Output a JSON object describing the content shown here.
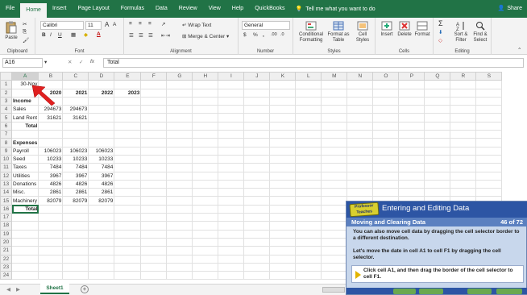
{
  "tabs": [
    "File",
    "Home",
    "Insert",
    "Page Layout",
    "Formulas",
    "Data",
    "Review",
    "View",
    "Help",
    "QuickBooks"
  ],
  "active_tab": "Home",
  "tell_me": "Tell me what you want to do",
  "share": "Share",
  "ribbon": {
    "paste": "Paste",
    "clipboard": "Clipboard",
    "font_name": "Calibri",
    "font_size": "11",
    "font_group": "Font",
    "wrap_text": "Wrap Text",
    "merge_center": "Merge & Center",
    "alignment_group": "Alignment",
    "number_format": "General",
    "number_group": "Number",
    "conditional": "Conditional Formatting",
    "format_table": "Format as Table",
    "cell_styles": "Cell Styles",
    "styles_group": "Styles",
    "insert": "Insert",
    "delete": "Delete",
    "format": "Format",
    "cells_group": "Cells",
    "sort_filter": "Sort & Filter",
    "find_select": "Find & Select",
    "editing_group": "Editing",
    "currency_symbol": "$",
    "percent": "%",
    "comma": ",",
    "bold": "B",
    "italic": "I",
    "underline": "U"
  },
  "formula_bar": {
    "name_box": "A16",
    "fx": "fx",
    "content": "Total"
  },
  "columns": [
    "A",
    "B",
    "C",
    "D",
    "E",
    "F",
    "G",
    "H",
    "I",
    "J",
    "K",
    "L",
    "M",
    "N",
    "O",
    "P",
    "Q",
    "R",
    "S"
  ],
  "rows": [
    [
      "30-Nov",
      "",
      "",
      "",
      ""
    ],
    [
      "",
      "2020",
      "2021",
      "2022",
      "2023"
    ],
    [
      "Income",
      "",
      "",
      "",
      ""
    ],
    [
      "Sales",
      "294673",
      "294673",
      "",
      ""
    ],
    [
      "Land Rent",
      "31621",
      "31621",
      "",
      ""
    ],
    [
      "Total",
      "",
      "",
      "",
      ""
    ],
    [
      "",
      "",
      "",
      "",
      ""
    ],
    [
      "Expenses",
      "",
      "",
      "",
      ""
    ],
    [
      "Payroll",
      "106023",
      "106023",
      "106023",
      ""
    ],
    [
      "Seed",
      "10233",
      "10233",
      "10233",
      ""
    ],
    [
      "Taxes",
      "7484",
      "7484",
      "7484",
      ""
    ],
    [
      "Utilities",
      "3967",
      "3967",
      "3967",
      ""
    ],
    [
      "Donations",
      "4826",
      "4826",
      "4826",
      ""
    ],
    [
      "Misc.",
      "2861",
      "2861",
      "2861",
      ""
    ],
    [
      "Machinery",
      "82079",
      "82079",
      "82079",
      ""
    ],
    [
      "Total",
      "",
      "",
      "",
      ""
    ],
    [
      "",
      "",
      "",
      "",
      ""
    ],
    [
      "",
      "",
      "",
      "",
      ""
    ],
    [
      "",
      "",
      "",
      "",
      ""
    ],
    [
      "",
      "",
      "",
      "",
      ""
    ],
    [
      "",
      "",
      "",
      "",
      ""
    ],
    [
      "",
      "",
      "",
      "",
      ""
    ],
    [
      "",
      "",
      "",
      "",
      ""
    ],
    [
      "",
      "",
      "",
      "",
      ""
    ]
  ],
  "sheet_tab": "Sheet1",
  "add_sheet": "+",
  "tutorial": {
    "logo": "Professor Teaches",
    "title": "Entering and Editing Data",
    "section": "Moving and Clearing Data",
    "page": "46 of 72",
    "para1": "You can also move cell data by dragging the cell selector border to a different destination.",
    "para2": "Let's move the date in cell A1 to cell F1 by dragging the cell selector.",
    "step": "Click cell A1, and then drag the border of the cell selector to cell F1."
  }
}
